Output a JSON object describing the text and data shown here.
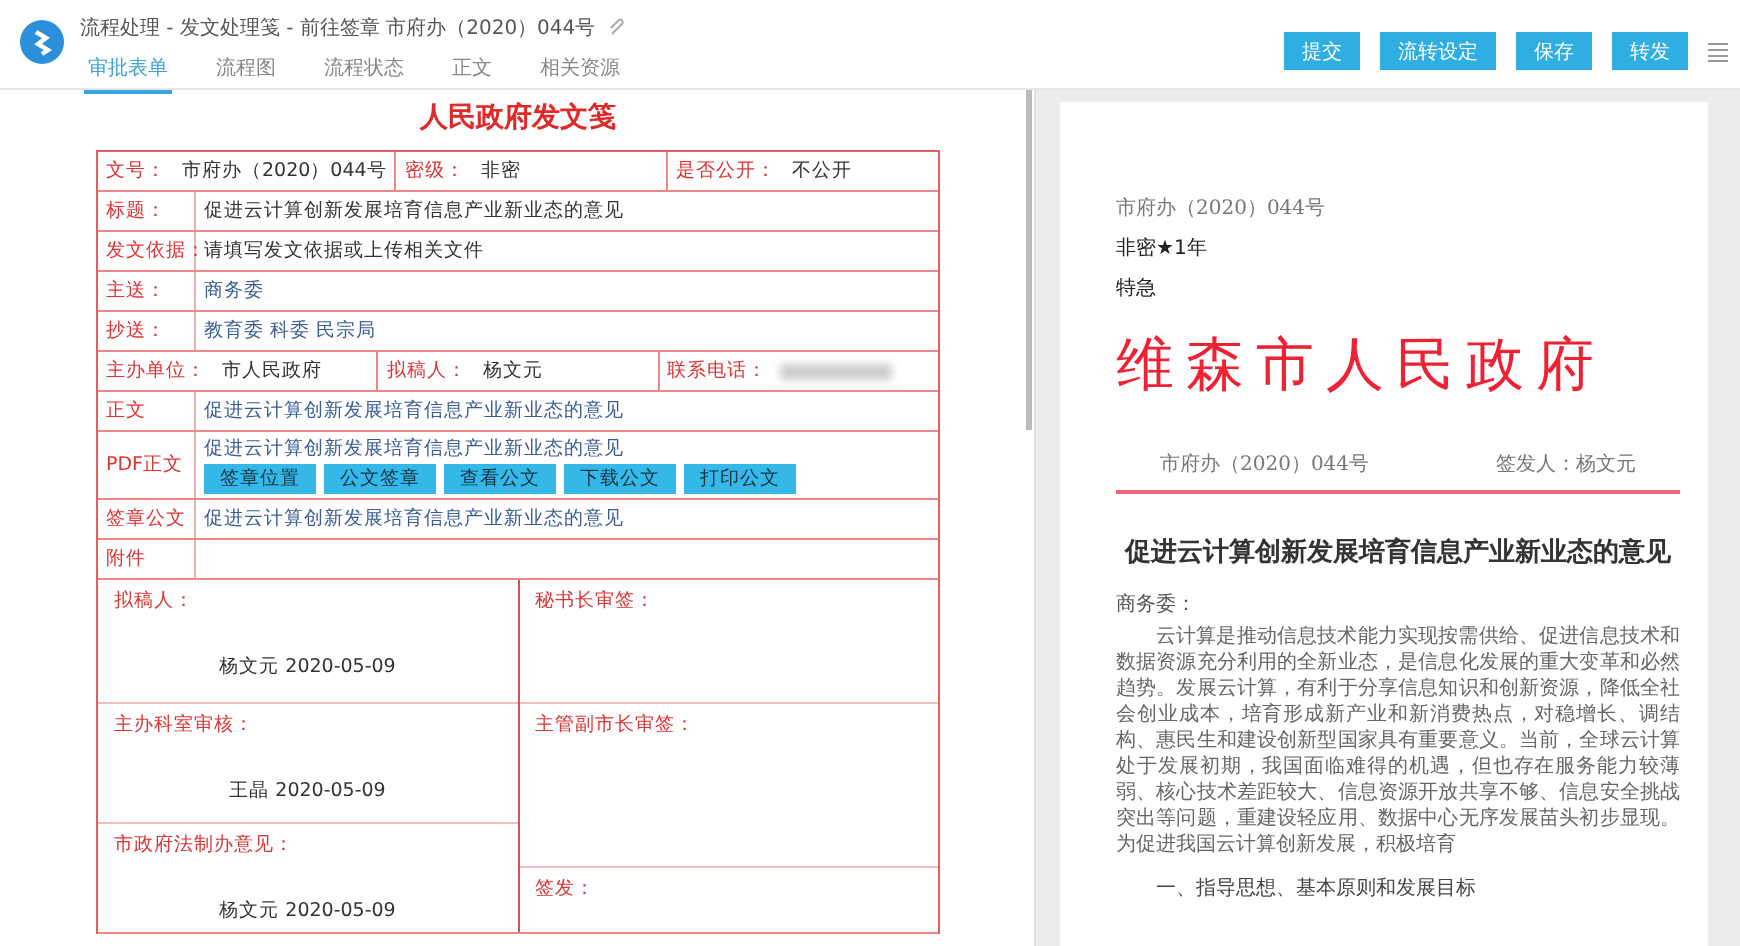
{
  "header": {
    "title": "流程处理 - 发文处理笺 - 前往签章 市府办（2020）044号",
    "tabs": [
      {
        "label": "审批表单",
        "selected": true
      },
      {
        "label": "流程图",
        "selected": false
      },
      {
        "label": "流程状态",
        "selected": false
      },
      {
        "label": "正文",
        "selected": false
      },
      {
        "label": "相关资源",
        "selected": false
      }
    ],
    "buttons": [
      "提交",
      "流转设定",
      "保存",
      "转发"
    ]
  },
  "form": {
    "title": "人民政府发文笺",
    "rows": [
      {
        "kind": "triple",
        "fields": [
          {
            "label": "文号：",
            "value": "市府办（2020）044号"
          },
          {
            "label": "密级：",
            "value": "非密"
          },
          {
            "label": "是否公开：",
            "value": "不公开"
          }
        ]
      },
      {
        "kind": "text",
        "label": "标题：",
        "value": "促进云计算创新发展培育信息产业新业态的意见"
      },
      {
        "kind": "text",
        "label": "发文依据：",
        "value": "请填写发文依据或上传相关文件"
      },
      {
        "kind": "names",
        "label": "主送：",
        "value": "商务委"
      },
      {
        "kind": "names",
        "label": "抄送：",
        "value": "教育委  科委  民宗局"
      },
      {
        "kind": "triple",
        "fields": [
          {
            "label": "主办单位：",
            "value": "市人民政府"
          },
          {
            "label": "拟稿人：",
            "value": "杨文元"
          },
          {
            "label": "联系电话：",
            "redacted": true
          }
        ]
      },
      {
        "kind": "link",
        "label": "正文",
        "value": "促进云计算创新发展培育信息产业新业态的意见"
      },
      {
        "kind": "actions",
        "label": "PDF正文",
        "value": "促进云计算创新发展培育信息产业新业态的意见",
        "buttons": [
          "签章位置",
          "公文签章",
          "查看公文",
          "下载公文",
          "打印公文"
        ]
      },
      {
        "kind": "link",
        "label": "签章公文",
        "value": "促进云计算创新发展培育信息产业新业态的意见"
      },
      {
        "kind": "empty",
        "label": "附件"
      }
    ],
    "approvals_left": [
      {
        "label": "拟稿人：",
        "signature": "杨文元 2020-05-09"
      },
      {
        "label": "主办科室审核：",
        "signature": "王晶 2020-05-09"
      },
      {
        "label": "市政府法制办意见：",
        "signature": "杨文元 2020-05-09"
      }
    ],
    "approvals_right": [
      {
        "label": "秘书长审签："
      },
      {
        "label": "主管副市长审签："
      },
      {
        "label": "签发："
      }
    ]
  },
  "document": {
    "doc_number": "市府办（2020）044号",
    "secrecy": "非密★1年",
    "urgency": "特急",
    "issuer": "维森市人民政府",
    "reference": "市府办（2020）044号",
    "signer": "签发人：杨文元",
    "title": "促进云计算创新发展培育信息产业新业态的意见",
    "salutation": "商务委：",
    "body": "云计算是推动信息技术能力实现按需供给、促进信息技术和数据资源充分利用的全新业态，是信息化发展的重大变革和必然趋势。发展云计算，有利于分享信息知识和创新资源，降低全社会创业成本，培育形成新产业和新消费热点，对稳增长、调结构、惠民生和建设创新型国家具有重要意义。当前，全球云计算处于发展初期，我国面临难得的机遇，但也存在服务能力较薄弱、核心技术差距较大、信息资源开放共享不够、信息安全挑战突出等问题，重建设轻应用、数据中心无序发展苗头初步显现。为促进我国云计算创新发展，积极培育",
    "heading": "一、指导思想、基本原则和发展目标"
  }
}
